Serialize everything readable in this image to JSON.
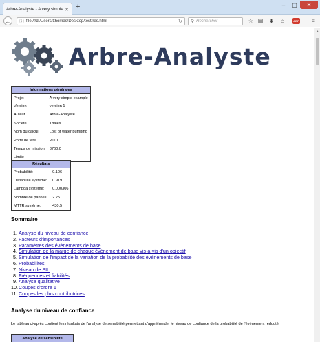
{
  "browser": {
    "tab_title": "Arbre-Analyste - A very simple ...",
    "url": "file:///d:/Users/tthomas/Desktop/test/res.html",
    "search_placeholder": "Rechercher",
    "abp_label": "ABP"
  },
  "page": {
    "title": "Arbre-Analyste",
    "info_table": {
      "header": "Informations générales",
      "rows": [
        {
          "label": "Projet",
          "value": "A very simple example"
        },
        {
          "label": "Version",
          "value": "version 1"
        },
        {
          "label": "Auteur",
          "value": "Arbre-Analyste"
        },
        {
          "label": "Société",
          "value": "Thales"
        },
        {
          "label": "Nom du calcul",
          "value": "Lost of water pumping"
        },
        {
          "label": "Porte de tête",
          "value": "P001"
        },
        {
          "label": "Temps de mission",
          "value": "8760.0"
        },
        {
          "label": "Limite",
          "value": ""
        }
      ]
    },
    "results_table": {
      "header": "Résultats",
      "rows": [
        {
          "label": "Probabilité:",
          "value": "0.106"
        },
        {
          "label": "Défiabilité système:",
          "value": "0.919"
        },
        {
          "label": "Lambda système:",
          "value": "0.000306"
        },
        {
          "label": "Nombre de pannes:",
          "value": "2.25"
        },
        {
          "label": "MTTR système:",
          "value": "430.5"
        }
      ]
    },
    "sommaire_heading": "Sommaire",
    "toc": [
      {
        "num": "1.",
        "label": "Analyse du niveau de confiance"
      },
      {
        "num": "2.",
        "label": "Facteurs d'importances"
      },
      {
        "num": "3.",
        "label": "Paramètres des évènements de base"
      },
      {
        "num": "4.",
        "label": "Simulation de la marge de chaque évènement de base vis-à-vis d'un objectif"
      },
      {
        "num": "5.",
        "label": "Simulation de l'impact de la variation de la probabilité des évènements de base"
      },
      {
        "num": "6.",
        "label": "Probabilités"
      },
      {
        "num": "7.",
        "label": "Niveau de SIL"
      },
      {
        "num": "8.",
        "label": "Fréquences et fiabilités"
      },
      {
        "num": "9.",
        "label": "Analyse qualitative"
      },
      {
        "num": "10.",
        "label": "Coupes d'ordre 1"
      },
      {
        "num": "11.",
        "label": "Coupes les plus contributrices"
      }
    ],
    "analyse_heading": "Analyse du niveau de confiance",
    "analyse_paragraph": "Le tableau ci-après contient les résultats de l'analyse de sensibilité permettant d'appréhender le niveau de confiance de la probabilité de l'évènement redouté.",
    "sensibility_table_header": "Analyse de sensibilité"
  }
}
